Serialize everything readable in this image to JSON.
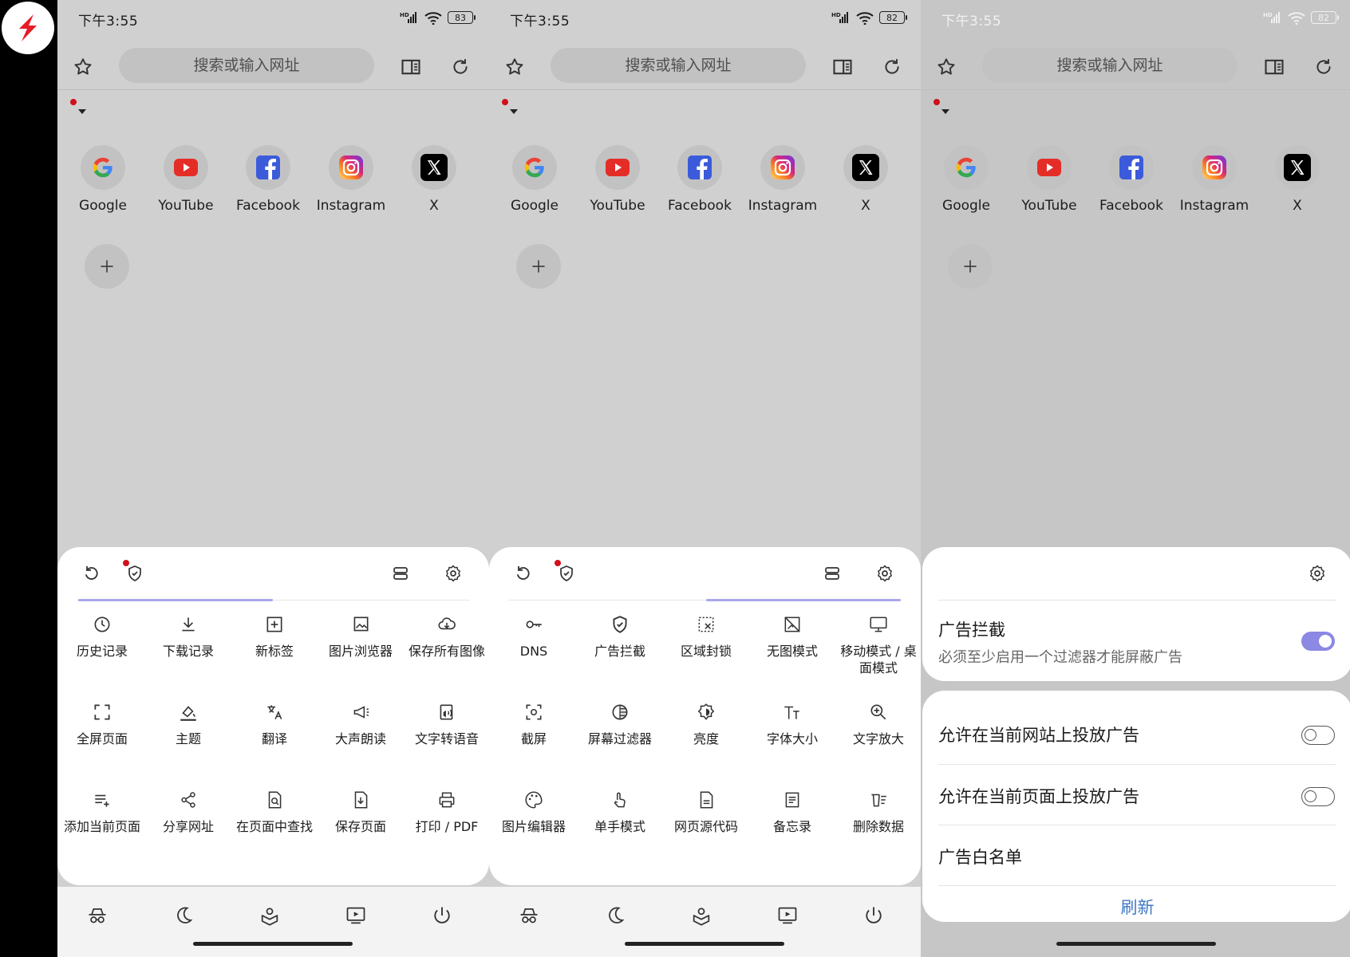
{
  "status": {
    "time": "下午3:55",
    "batteries": [
      "83",
      "82",
      "82"
    ],
    "network_label": "HD"
  },
  "toolbar": {
    "search_placeholder": "搜索或输入网址"
  },
  "shortcuts": [
    "Google",
    "YouTube",
    "Facebook",
    "Instagram",
    "X"
  ],
  "menu_page1": [
    "历史记录",
    "下载记录",
    "新标签",
    "图片浏览器",
    "保存所有图像",
    "全屏页面",
    "主题",
    "翻译",
    "大声朗读",
    "文字转语音",
    "添加当前页面",
    "分享网址",
    "在页面中查找",
    "保存页面",
    "打印 / PDF"
  ],
  "menu_page2": [
    "DNS",
    "广告拦截",
    "区域封锁",
    "无图模式",
    "移动模式 / 桌面模式",
    "截屏",
    "屏幕过滤器",
    "亮度",
    "字体大小",
    "文字放大",
    "图片编辑器",
    "单手模式",
    "网页源代码",
    "备忘录",
    "删除数据"
  ],
  "adblock": {
    "title": "广告拦截",
    "subtitle": "必须至少启用一个过滤器才能屏蔽广告",
    "enabled": true,
    "allow_site": "允许在当前网站上投放广告",
    "allow_page": "允许在当前页面上投放广告",
    "whitelist": "广告白名单",
    "refresh": "刷新"
  },
  "colors": {
    "accent": "#8b89e3",
    "link": "#3f78c6",
    "notify": "#d0101a"
  }
}
